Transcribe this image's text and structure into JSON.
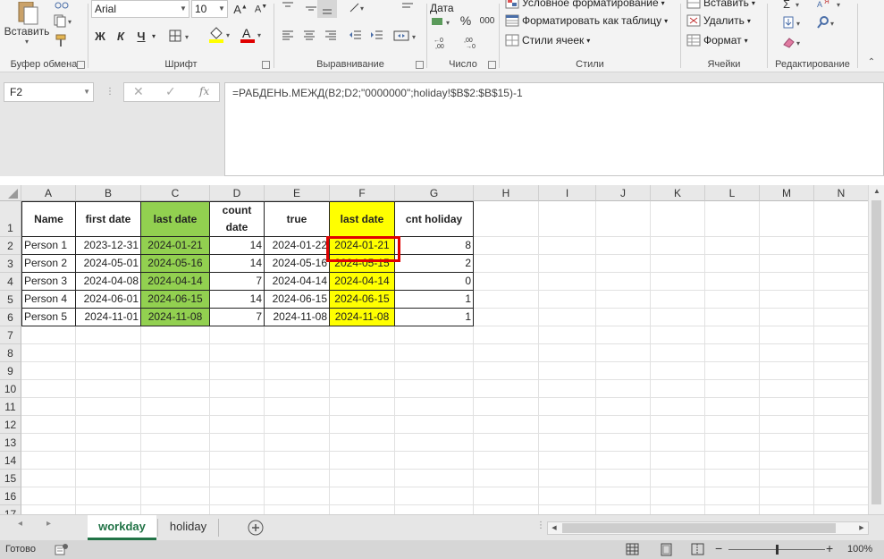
{
  "ribbon": {
    "clipboard": {
      "label": "Буфер обмена",
      "paste_label": "Вставить"
    },
    "font": {
      "label": "Шрифт",
      "font_name": "Arial",
      "font_size": "10",
      "bold": "Ж",
      "italic": "К",
      "underline": "Ч"
    },
    "alignment": {
      "label": "Выравнивание"
    },
    "number": {
      "label": "Число",
      "format": "Дата",
      "percent": "%",
      "thousands": "000"
    },
    "styles": {
      "label": "Стили",
      "conditional": "Условное форматирование",
      "as_table": "Форматировать как таблицу",
      "cell_styles": "Стили ячеек"
    },
    "cells": {
      "label": "Ячейки",
      "insert": "Вставить",
      "delete": "Удалить",
      "format": "Формат"
    },
    "editing": {
      "label": "Редактирование"
    }
  },
  "formula_bar": {
    "name_box": "F2",
    "fx": "fx",
    "cancel": "✕",
    "enter": "✓",
    "formula": "=РАБДЕНЬ.МЕЖД(B2;D2;\"0000000\";holiday!$B$2:$B$15)-1"
  },
  "columns": [
    "A",
    "B",
    "C",
    "D",
    "E",
    "F",
    "G",
    "H",
    "I",
    "J",
    "K",
    "L",
    "M",
    "N"
  ],
  "rows": [
    "1",
    "2",
    "3",
    "4",
    "5",
    "6",
    "7",
    "8",
    "9",
    "10",
    "11",
    "12",
    "13",
    "14",
    "15",
    "16",
    "17"
  ],
  "table": {
    "headers": [
      "Name",
      "first date",
      "last date",
      "count date",
      "true",
      "last date",
      "cnt holiday"
    ],
    "rows": [
      [
        "Person 1",
        "2023-12-31",
        "2024-01-21",
        "14",
        "2024-01-22",
        "2024-01-21",
        "8"
      ],
      [
        "Person 2",
        "2024-05-01",
        "2024-05-16",
        "14",
        "2024-05-16",
        "2024-05-15",
        "2"
      ],
      [
        "Person 3",
        "2024-04-08",
        "2024-04-14",
        "7",
        "2024-04-14",
        "2024-04-14",
        "0"
      ],
      [
        "Person 4",
        "2024-06-01",
        "2024-06-15",
        "14",
        "2024-06-15",
        "2024-06-15",
        "1"
      ],
      [
        "Person 5",
        "2024-11-01",
        "2024-11-08",
        "7",
        "2024-11-08",
        "2024-11-08",
        "1"
      ]
    ]
  },
  "colors": {
    "green": "#92d050",
    "yellow": "#ffff00",
    "accent": "#217346",
    "highlight": "#e00000"
  },
  "sheets": [
    {
      "name": "workday",
      "active": true
    },
    {
      "name": "holiday",
      "active": false
    }
  ],
  "status": {
    "ready": "Готово",
    "zoom": "100%"
  }
}
